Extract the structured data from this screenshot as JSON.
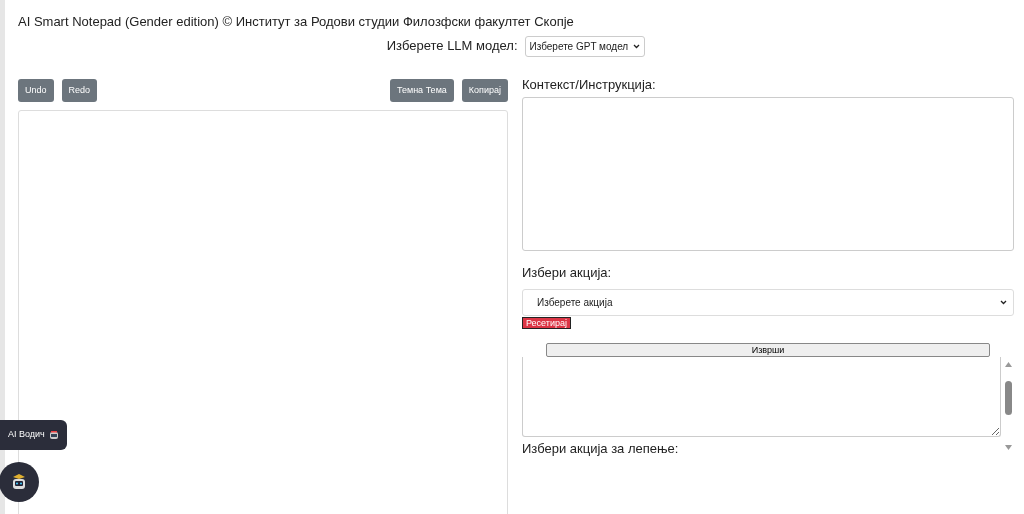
{
  "title": "AI Smart Notepad (Gender edition) © Институт за Родови студии Филозфски факултет Скопје",
  "model": {
    "label": "Изберете LLM модел:",
    "value": "Изберете GPT модел"
  },
  "editor_toolbar": {
    "left": [
      "Undo",
      "Redo"
    ],
    "right": [
      "Темна Тема",
      "Копирај"
    ]
  },
  "context": {
    "label": "Контекст/Инструкција:"
  },
  "action": {
    "label": "Избери акција:",
    "value": "Изберете акција",
    "reset": "Ресетирај",
    "execute": "Изврши"
  },
  "paste": {
    "label": "Избери акција за лепење:"
  },
  "guide": {
    "label": "AI Водич"
  }
}
